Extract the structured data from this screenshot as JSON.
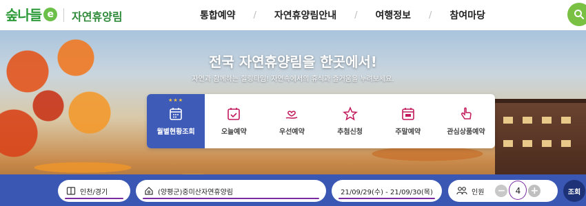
{
  "header": {
    "logo_text": "숲나들",
    "logo_mark": "e",
    "site_name": "자연휴양림",
    "nav": [
      "통합예약",
      "자연휴양림안내",
      "여행정보",
      "참여마당"
    ],
    "separator": "/"
  },
  "hero": {
    "title": "전국 자연휴양림을 한곳에서!",
    "subtitle": "자연과 함께하는 힐링타임! 자연속에서의 휴식과 즐거움을 누려보세요."
  },
  "quick_menu": {
    "items": [
      {
        "label": "월별현황조회",
        "icon": "calendar-grid-icon",
        "active": true
      },
      {
        "label": "오늘예약",
        "icon": "calendar-check-icon",
        "active": false
      },
      {
        "label": "우선예약",
        "icon": "hand-heart-icon",
        "active": false
      },
      {
        "label": "추첨신청",
        "icon": "star-badge-icon",
        "active": false
      },
      {
        "label": "주말예약",
        "icon": "calendar-week-icon",
        "active": false
      },
      {
        "label": "관심상품예약",
        "icon": "pointer-hand-icon",
        "active": false
      }
    ],
    "active_stars": "★★★"
  },
  "search": {
    "region": "인천/경기",
    "forest": "(양평군)중미산자연휴양림",
    "dates": "21/09/29(수) - 21/09/30(목)",
    "people_label": "인원",
    "people_count": "4",
    "minus": "−",
    "plus": "+",
    "submit": "조회"
  },
  "colors": {
    "brand_green": "#2e9b3a",
    "accent_blue": "#3a57b4",
    "active_tab": "#3f5bb8",
    "annotation_purple": "#7a2aa0"
  }
}
